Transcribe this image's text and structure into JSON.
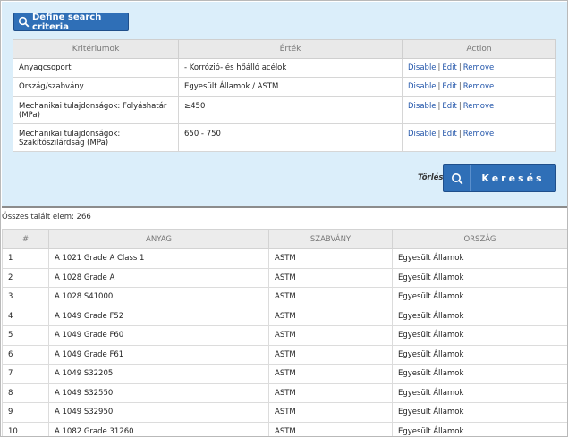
{
  "criteria_section": {
    "define_button_label": "Define search criteria",
    "columns": [
      "Kritériumok",
      "Érték",
      "Action"
    ],
    "rows": [
      {
        "criterion": "Anyagcsoport",
        "value": "- Korrózió- és hőálló acélok"
      },
      {
        "criterion": "Ország/szabvány",
        "value": "Egyesült Államok / ASTM"
      },
      {
        "criterion": "Mechanikai tulajdonságok: Folyáshatár (MPa)",
        "value": "≥450"
      },
      {
        "criterion": "Mechanikai tulajdonságok: Szakítószilárdság (MPa)",
        "value": "650 - 750"
      }
    ],
    "actions": {
      "disable": "Disable",
      "edit": "Edit",
      "remove": "Remove",
      "separator": "|"
    },
    "clear_label": "Törlés",
    "search_label": "Keresés"
  },
  "results": {
    "total_text": "Összes talált elem: 266",
    "columns": [
      "#",
      "ANYAG",
      "SZABVÁNY",
      "ORSZÁG"
    ],
    "rows": [
      {
        "num": "1",
        "material": "A 1021 Grade A Class 1",
        "standard": "ASTM",
        "country": "Egyesült Államok"
      },
      {
        "num": "2",
        "material": "A 1028 Grade A",
        "standard": "ASTM",
        "country": "Egyesült Államok"
      },
      {
        "num": "3",
        "material": "A 1028 S41000",
        "standard": "ASTM",
        "country": "Egyesült Államok"
      },
      {
        "num": "4",
        "material": "A 1049 Grade F52",
        "standard": "ASTM",
        "country": "Egyesült Államok"
      },
      {
        "num": "5",
        "material": "A 1049 Grade F60",
        "standard": "ASTM",
        "country": "Egyesült Államok"
      },
      {
        "num": "6",
        "material": "A 1049 Grade F61",
        "standard": "ASTM",
        "country": "Egyesült Államok"
      },
      {
        "num": "7",
        "material": "A 1049 S32205",
        "standard": "ASTM",
        "country": "Egyesült Államok"
      },
      {
        "num": "8",
        "material": "A 1049 S32550",
        "standard": "ASTM",
        "country": "Egyesült Államok"
      },
      {
        "num": "9",
        "material": "A 1049 S32950",
        "standard": "ASTM",
        "country": "Egyesült Államok"
      },
      {
        "num": "10",
        "material": "A 1082 Grade 31260",
        "standard": "ASTM",
        "country": "Egyesült Államok"
      }
    ]
  },
  "icons": {
    "define": "search-icon",
    "search": "search-icon"
  },
  "colors": {
    "panel_bg": "#dbeefa",
    "button_blue": "#2f6fb7",
    "link_blue": "#2255aa"
  }
}
